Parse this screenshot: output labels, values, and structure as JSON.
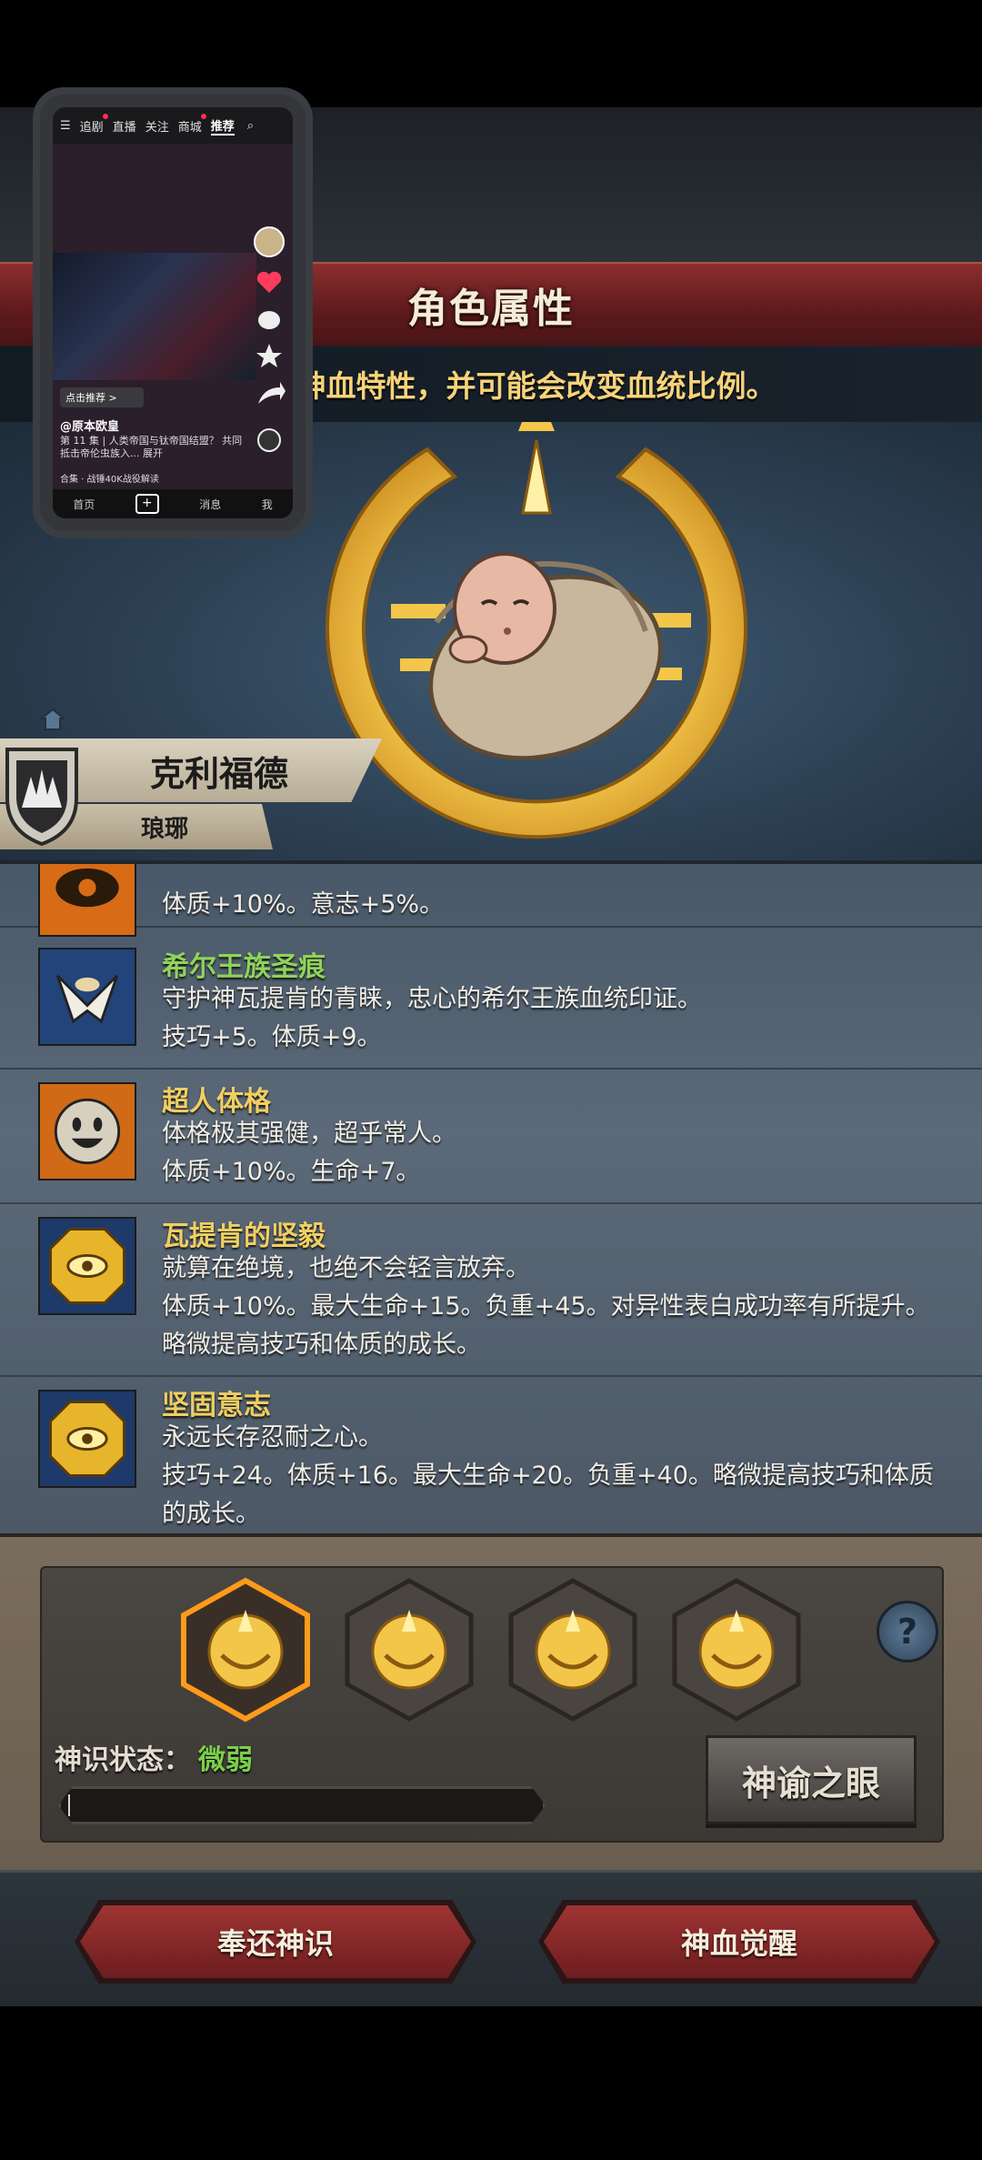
{
  "header": {
    "title": "角色属性",
    "subtitle": "会获得神血特性，并可能会改变血统比例。"
  },
  "character": {
    "name": "克利福德",
    "title": "琅琊"
  },
  "traits": [
    {
      "name": "",
      "desc": "",
      "effects": "体质+10%。意志+5%。",
      "icon": "eye-sun-icon"
    },
    {
      "name": "希尔王族圣痕",
      "desc": "守护神瓦提肯的青睐，忠心的希尔王族血统印证。",
      "effects": "技巧+5。体质+9。",
      "icon": "white-eagle-icon"
    },
    {
      "name": "超人体格",
      "desc": "体格极其强健，超乎常人。",
      "effects": "体质+10%。生命+7。",
      "icon": "smiley-sun-icon"
    },
    {
      "name": "瓦提肯的坚毅",
      "desc": "就算在绝境，也绝不会轻言放弃。",
      "effects": "体质+10%。最大生命+15。负重+45。对异性表白成功率有所提升。",
      "extra": "略微提高技巧和体质的成长。",
      "icon": "gold-eye-medal-icon"
    },
    {
      "name": "坚固意志",
      "desc": "永远长存忍耐之心。",
      "effects": "技巧+24。体质+16。最大生命+20。负重+40。略微提高技巧和体质",
      "extra": "的成长。",
      "icon": "gold-eye-medal-icon"
    }
  ],
  "awakening": {
    "status_label": "神识状态：",
    "status_value": "微弱",
    "oracle_button": "神谕之眼",
    "help": "?",
    "progress": 0.0,
    "selected_slot": 0
  },
  "actions": {
    "return_button": "奉还神识",
    "awaken_button": "神血觉醒"
  },
  "pip": {
    "tabs": [
      "追剧",
      "直播",
      "关注",
      "商城",
      "推荐"
    ],
    "like_label": "点击推荐 >",
    "author": "@原本欧皇",
    "desc": "第 11 集 | 人类帝国与钛帝国结盟？ 共同抵击帝伦虫族入... 展开",
    "topic": "合集 · 战锤40K战役解读",
    "nav": [
      "首页",
      "消息",
      "我"
    ]
  },
  "colors": {
    "trait_name_green": "#8fd35a",
    "trait_name_gold": "#f0cf62",
    "banner_red": "#8c2e2e",
    "status_green": "#7ad04a"
  }
}
